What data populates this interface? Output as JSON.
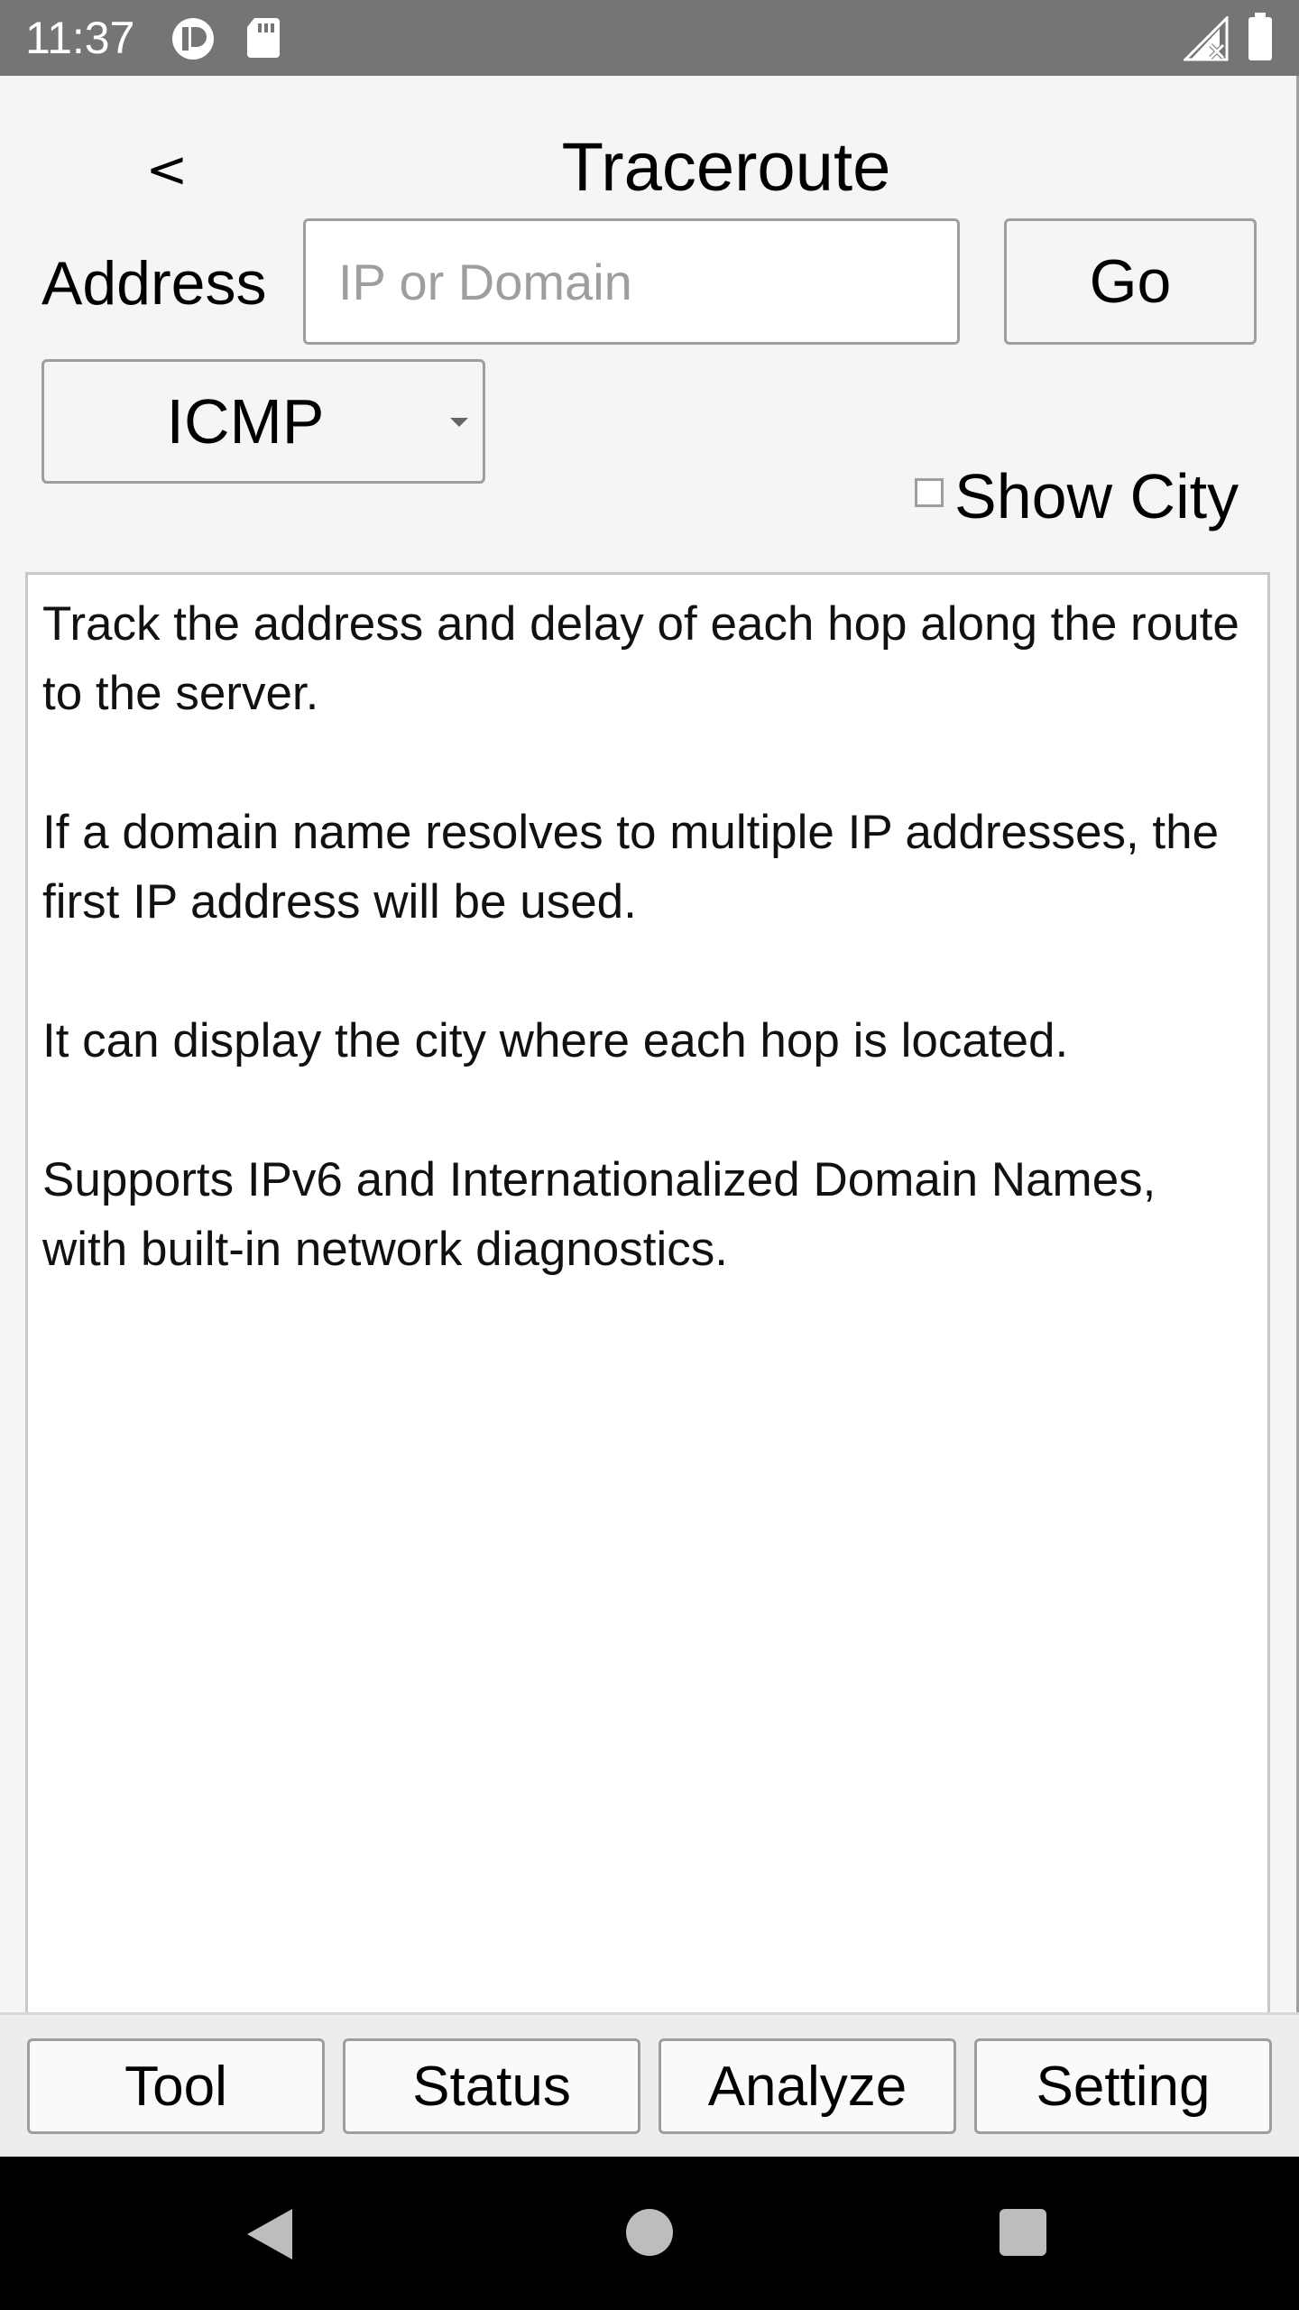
{
  "status_bar": {
    "time": "11:37",
    "icons": [
      "media-icon",
      "sd-card-icon",
      "no-signal-icon",
      "battery-icon"
    ]
  },
  "header": {
    "back_label": "<",
    "title": "Traceroute"
  },
  "form": {
    "address_label": "Address",
    "address_value": "",
    "address_placeholder": "IP or Domain",
    "go_label": "Go",
    "protocol_selected": "ICMP",
    "show_city_label": "Show City",
    "show_city_checked": false
  },
  "output": {
    "paragraphs": [
      "Track the address and delay of each hop along the route to the server.",
      "If a domain name resolves to multiple IP addresses, the first IP address will be used.",
      "It can display the city where each hop is located.",
      "Supports IPv6 and Internationalized Domain Names, with built-in network diagnostics."
    ]
  },
  "tabs": [
    {
      "label": "Tool"
    },
    {
      "label": "Status"
    },
    {
      "label": "Analyze"
    },
    {
      "label": "Setting"
    }
  ],
  "nav": {
    "icons": [
      "back-icon",
      "home-icon",
      "recents-icon"
    ]
  },
  "colors": {
    "status_bar": "#757575",
    "background": "#f5f5f5",
    "border": "#9e9e9e",
    "nav_bar": "#000000"
  }
}
